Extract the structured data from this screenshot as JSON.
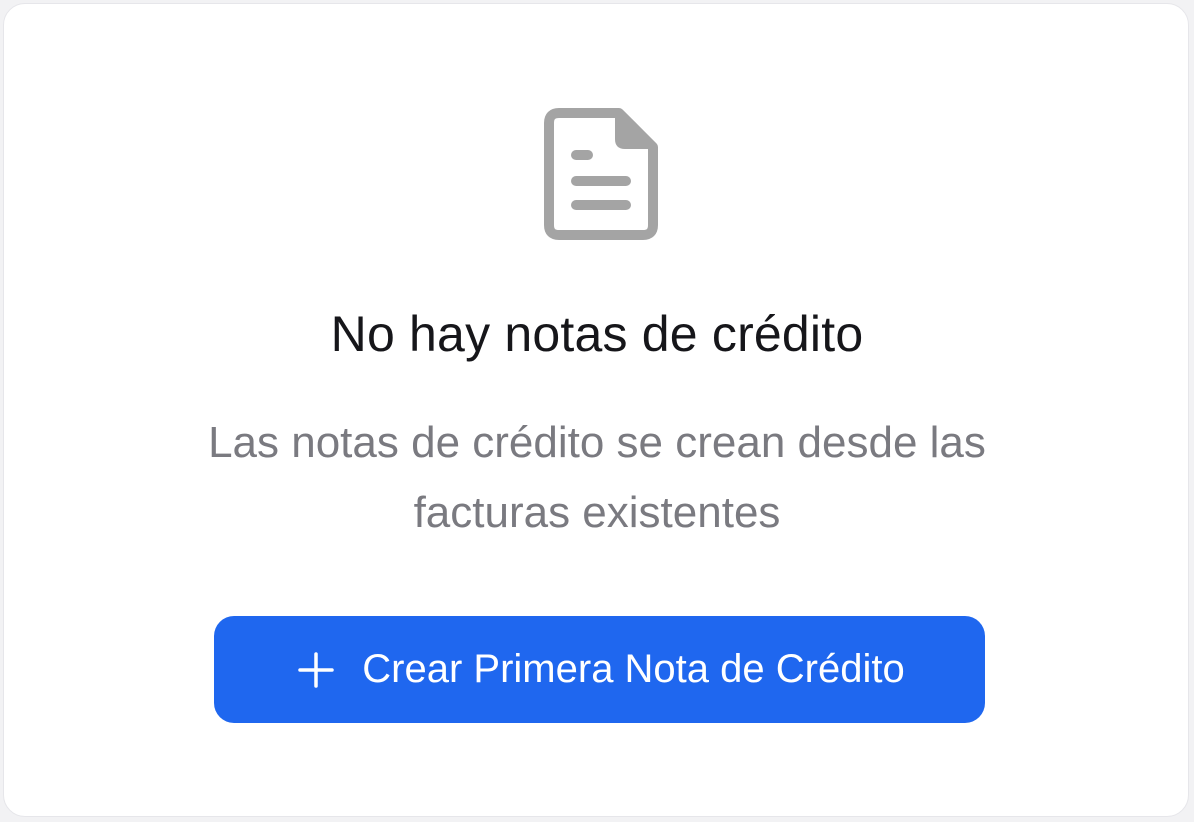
{
  "empty_state": {
    "icon": "document-icon",
    "title": "No hay notas de crédito",
    "description": "Las notas de crédito se crean desde las facturas existentes",
    "cta": {
      "icon": "plus-icon",
      "label": "Crear Primera Nota de Crédito"
    }
  },
  "colors": {
    "accent": "#1f67ef",
    "icon": "#a4a4a4",
    "title": "#16161a",
    "description": "#7a7a80",
    "card_background": "#ffffff",
    "page_background": "#f2f2f4"
  }
}
